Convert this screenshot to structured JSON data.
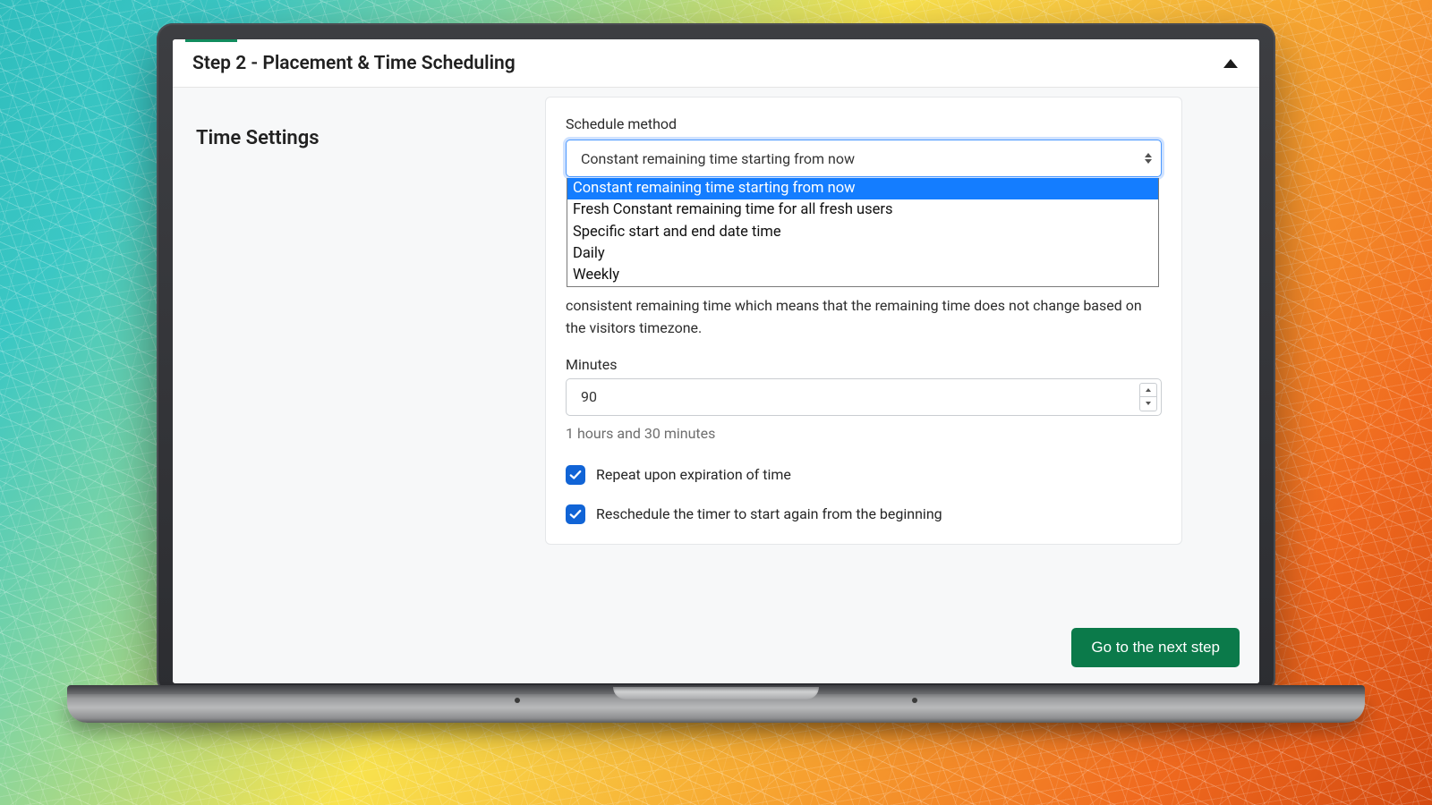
{
  "header": {
    "title": "Step 2 - Placement & Time Scheduling"
  },
  "sidebar": {
    "section_title": "Time Settings"
  },
  "schedule": {
    "label": "Schedule method",
    "selected": "Constant remaining time starting from now",
    "options": [
      "Constant remaining time starting from now",
      "Fresh Constant remaining time for all fresh users",
      "Specific start and end date time",
      "Daily",
      "Weekly"
    ]
  },
  "description": "consistent remaining time which means that the remaining time does not change based on the visitors timezone.",
  "minutes": {
    "label": "Minutes",
    "value": "90",
    "hint": "1 hours and 30 minutes"
  },
  "checks": {
    "repeat": "Repeat upon expiration of time",
    "reschedule": "Reschedule the timer to start again from the beginning"
  },
  "cta": "Go to the next step",
  "colors": {
    "accent_green": "#0b7a4a",
    "focus_blue": "#147dff",
    "checkbox_blue": "#1164d6"
  }
}
